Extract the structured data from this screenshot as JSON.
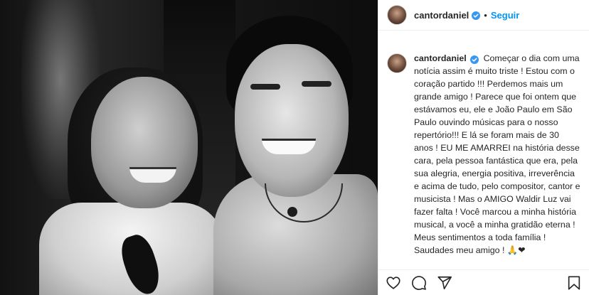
{
  "post": {
    "username": "cantordaniel",
    "follow_label": "Seguir",
    "separator": "•",
    "caption": "Começar o dia com uma notícia assim é muito triste ! Estou com o coração partido !!! Perdemos mais um grande amigo ! Parece que foi ontem que estávamos eu, ele e João Paulo em São Paulo ouvindo músicas para o nosso repertório!!! E lá se foram mais de 30 anos ! EU ME AMARREI na história desse cara, pela pessoa fantástica que era, pela sua alegria, energia positiva, irreverência e acima de tudo, pelo compositor, cantor e musicista ! Mas o AMIGO Waldir Luz vai fazer falta ! Você marcou a minha história musical, a você a minha gratidão eterna ! Meus sentimentos a toda família ! Saudades meu amigo ! 🙏❤"
  },
  "icons": {
    "verified": "verified-badge-icon",
    "like": "heart-icon",
    "comment": "comment-icon",
    "share": "paper-plane-icon",
    "save": "bookmark-icon"
  },
  "colors": {
    "link_blue": "#0095f6",
    "verified_blue": "#3897f0",
    "text": "#262626",
    "border": "#efefef"
  }
}
